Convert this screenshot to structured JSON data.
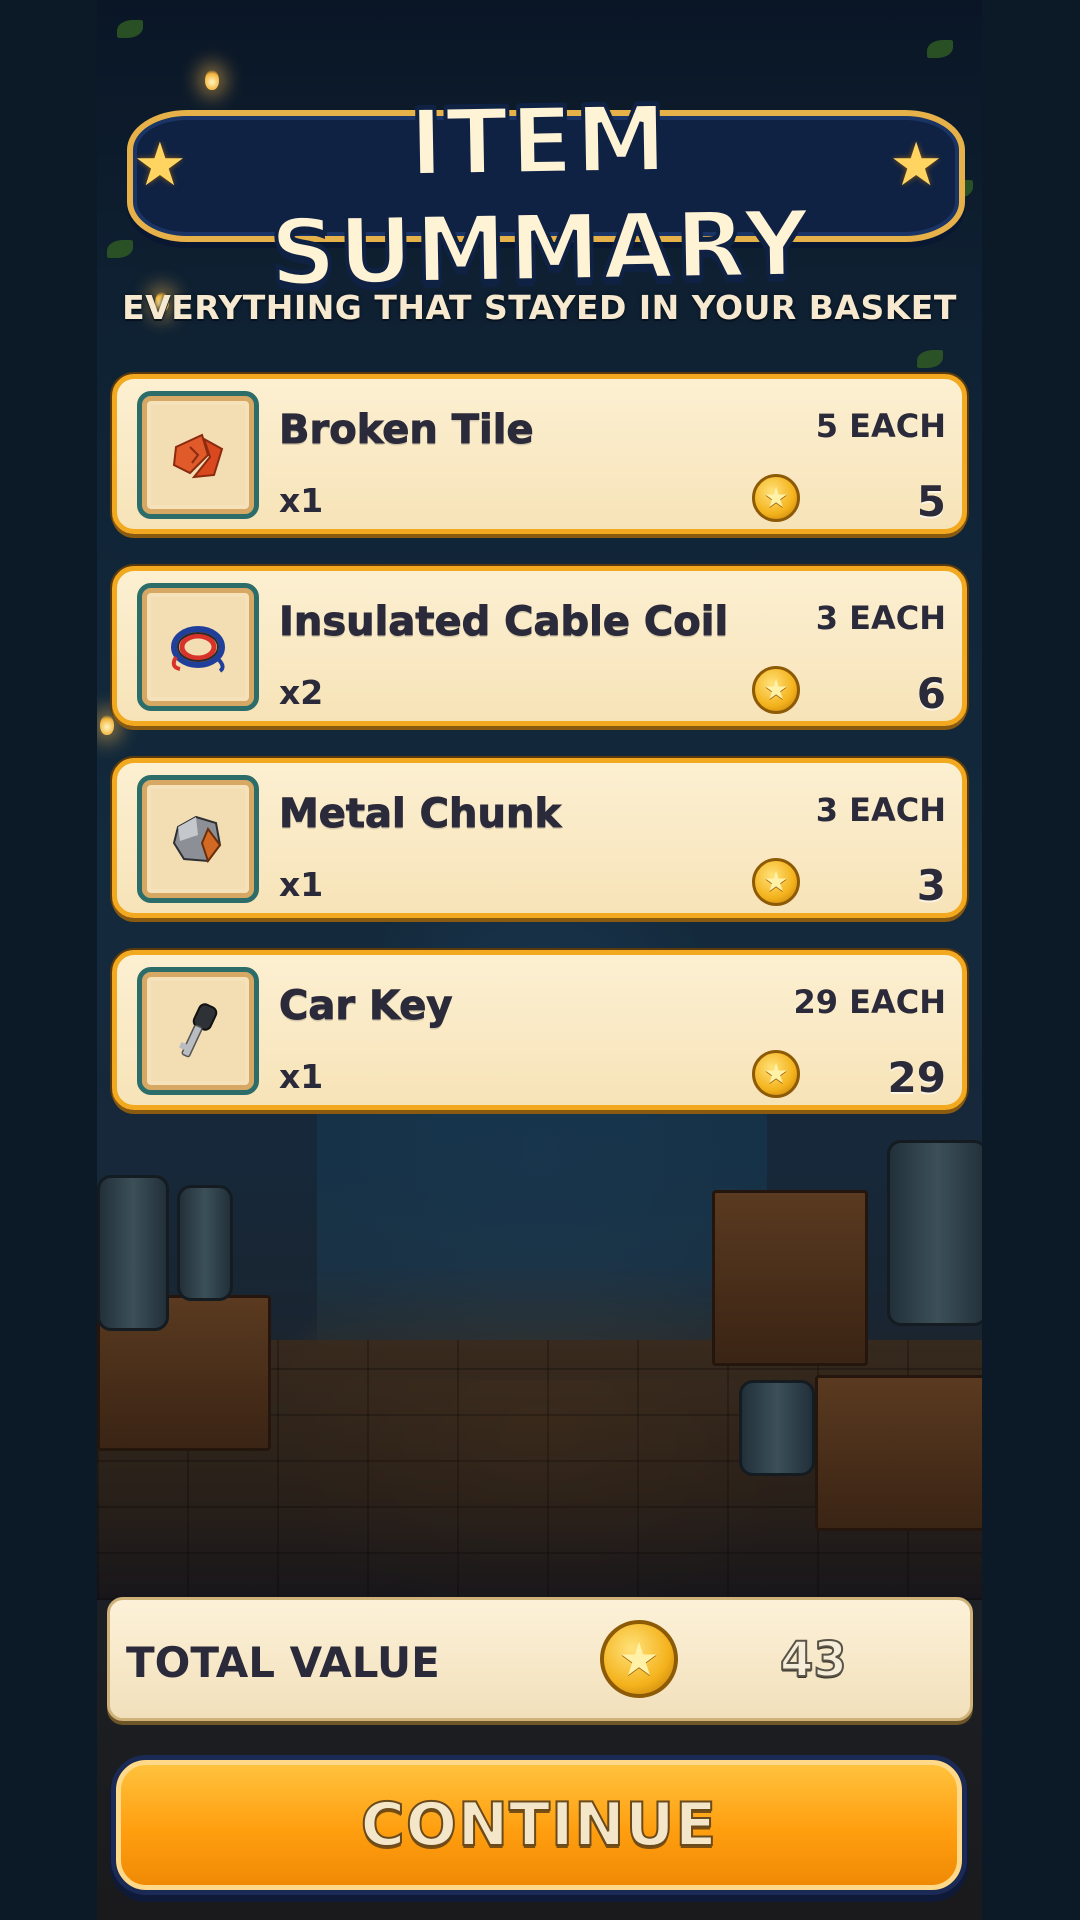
{
  "header": {
    "title": "ITEM SUMMARY",
    "subtitle": "EVERYTHING THAT STAYED IN YOUR BASKET",
    "title_icons": [
      "star-icon",
      "star-icon"
    ]
  },
  "items": [
    {
      "name": "Broken Tile",
      "quantity": "x1",
      "each": "5 EACH",
      "value": "5",
      "icon": "broken-tile-icon"
    },
    {
      "name": "Insulated Cable Coil",
      "quantity": "x2",
      "each": "3 EACH",
      "value": "6",
      "icon": "cable-coil-icon"
    },
    {
      "name": "Metal Chunk",
      "quantity": "x1",
      "each": "3 EACH",
      "value": "3",
      "icon": "metal-chunk-icon"
    },
    {
      "name": "Car Key",
      "quantity": "x1",
      "each": "29 EACH",
      "value": "29",
      "icon": "car-key-icon"
    }
  ],
  "currency_icon": "gold-star-coin-icon",
  "total": {
    "label": "TOTAL VALUE",
    "value": "43"
  },
  "continue_button": {
    "label": "CONTINUE"
  },
  "colors": {
    "card_bg": "#f9e8c4",
    "card_border": "#f2a81f",
    "thumb_border": "#2c6d6a",
    "button": "#ff9e0f",
    "title_banner": "#0f2244",
    "text_dark": "#2b2a3a"
  }
}
